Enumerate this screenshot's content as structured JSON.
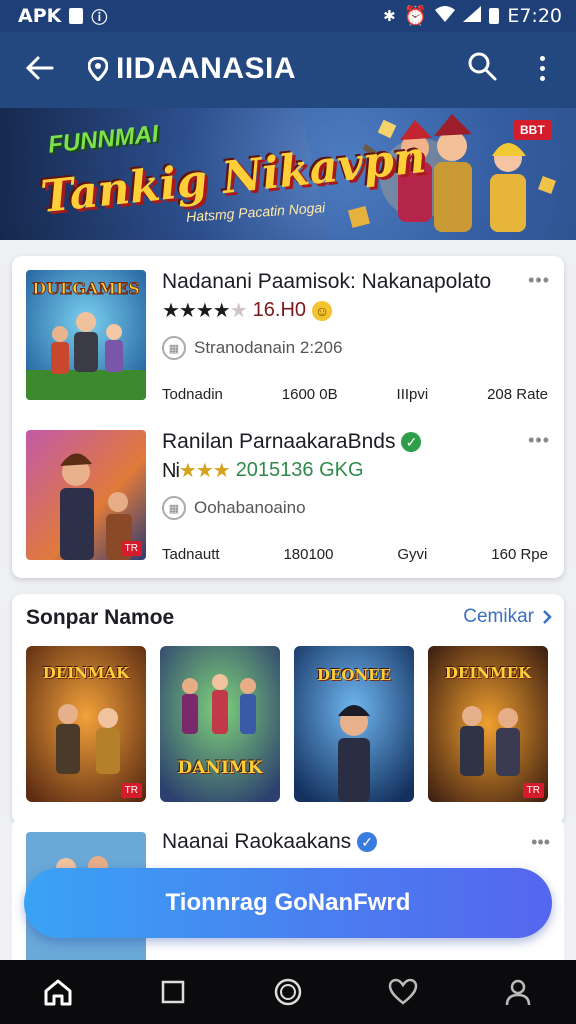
{
  "status": {
    "left_text": "APK",
    "time": "E7:20"
  },
  "appbar": {
    "title": "IIDAANASIA"
  },
  "banner": {
    "top_text": "FUNNMAI",
    "main_text": "Tankig Nikavpn",
    "sub_text": "Hatsmg Pacatin Nogai",
    "badge": "BBT"
  },
  "list": [
    {
      "name": "Nadanani Paamisok: Nakanapolato",
      "rating": "16.H0",
      "publisher": "Stranodanain 2:206",
      "meta": [
        "Todnadin",
        "1600 0B",
        "IIIpvi",
        "208 Rate"
      ],
      "thumb_label": "DUEGAMES",
      "verified": false
    },
    {
      "name": "Ranilan ParnaakaraBnds",
      "rating": "2015136 GKG",
      "rating_prefix": "Ni",
      "publisher": "Oohabanoaino",
      "meta": [
        "Tadnautt",
        "180100",
        "Gyvi",
        "160 Rpe"
      ],
      "thumb_label": "",
      "thumb_tag": "TR",
      "verified": true
    }
  ],
  "section": {
    "heading": "Sonpar Namoe",
    "link": "Cemikar",
    "tiles": [
      {
        "label": "DEINMAK",
        "tag": "TR"
      },
      {
        "label": "DANIMK",
        "tag": ""
      },
      {
        "label": "DEONEE",
        "tag": ""
      },
      {
        "label": "DEINMEK",
        "tag": "TR"
      }
    ]
  },
  "third_item": {
    "name": "Naanai Raokaakans"
  },
  "cta": {
    "label": "Tionnrag GoNanFwrd"
  },
  "colors": {
    "appbar": "#234880",
    "cta_start": "#39a3f5",
    "cta_end": "#5566ef",
    "star": "#d4a21c"
  }
}
